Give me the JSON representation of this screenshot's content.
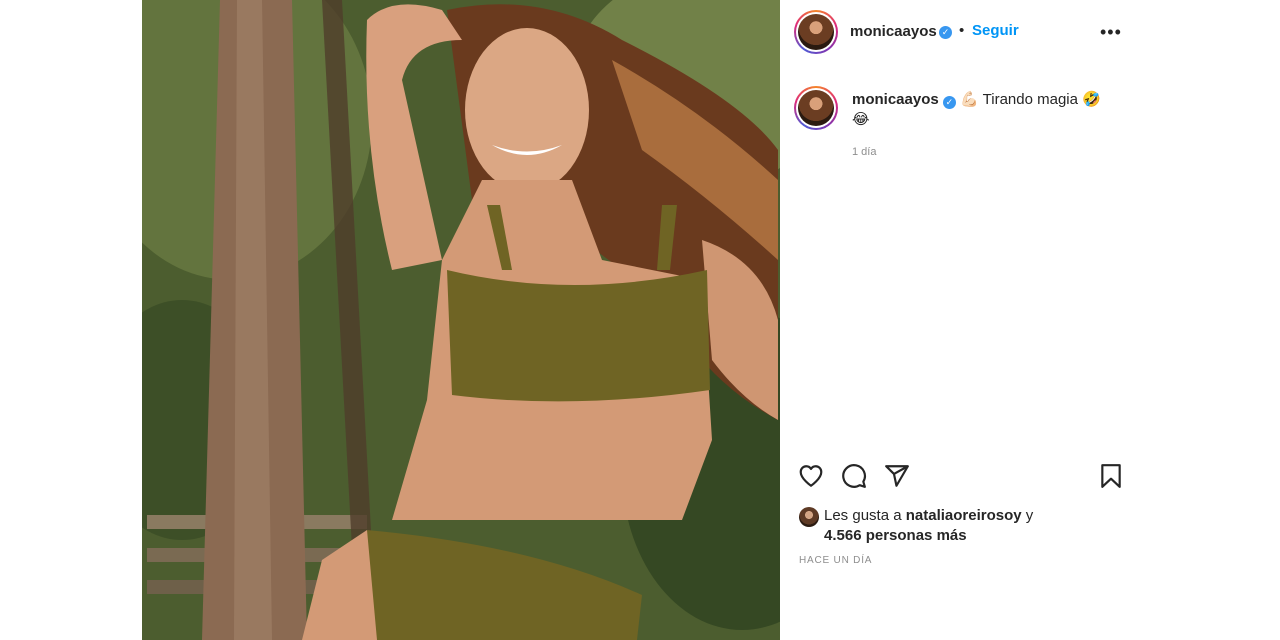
{
  "post": {
    "author": "monicaayos",
    "follow_label": "Seguir",
    "separator": "•",
    "more_label": "•••",
    "caption_text": "Tirando magia",
    "caption_emoji_1": "💪🏻",
    "caption_emoji_2": "🤣",
    "caption_emoji_3": "😂",
    "caption_time": "1 día",
    "likes_prefix": "Les gusta a",
    "likes_user": "nataliaoreirosoy",
    "likes_conjunction": "y",
    "likes_rest": "4.566 personas más",
    "posted_ago": "HACE UN DÍA"
  },
  "colors": {
    "accent": "#0095f6",
    "verified": "#3897f0",
    "muted": "#8e8e8e",
    "text": "#262626"
  },
  "icons": {
    "like": "heart-outline-icon",
    "comment": "speech-bubble-icon",
    "share": "paper-plane-icon",
    "save": "bookmark-outline-icon",
    "verified": "verified-check-icon",
    "more": "ellipsis-icon"
  }
}
